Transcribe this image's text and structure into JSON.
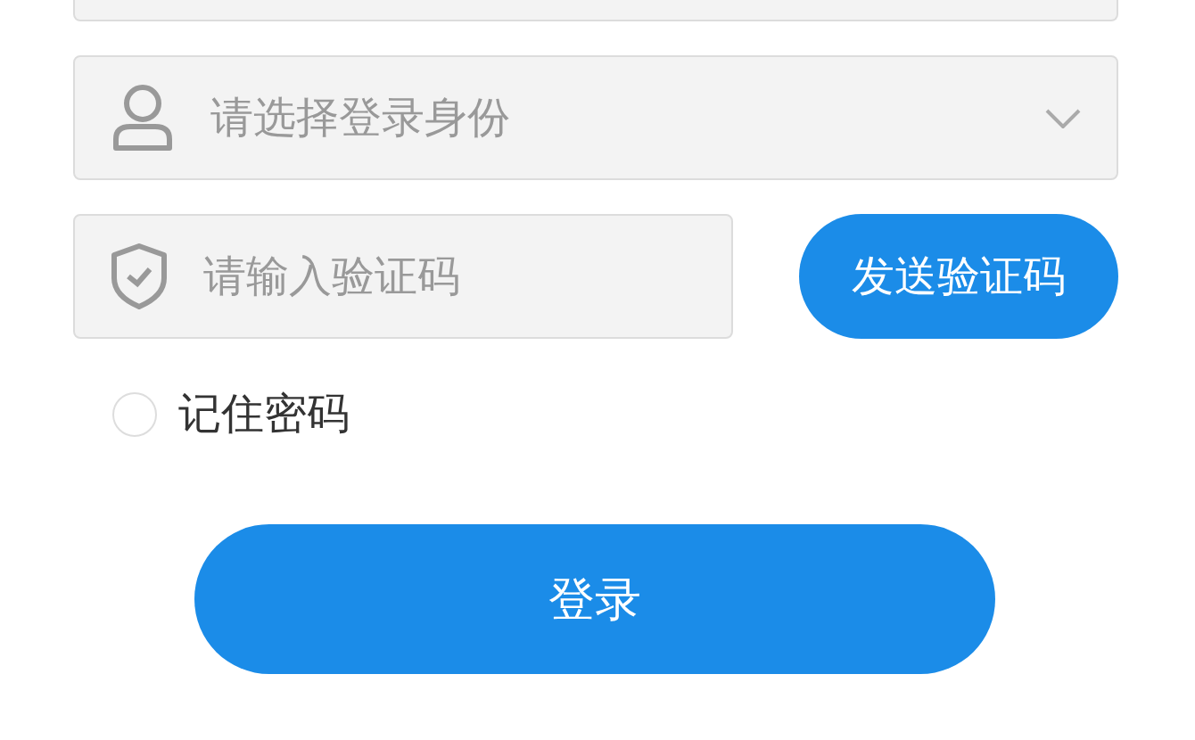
{
  "identity_select": {
    "placeholder": "请选择登录身份"
  },
  "code_field": {
    "placeholder": "请输入验证码"
  },
  "send_code_button": {
    "label": "发送验证码"
  },
  "remember": {
    "label": "记住密码",
    "checked": false
  },
  "login_button": {
    "label": "登录"
  }
}
